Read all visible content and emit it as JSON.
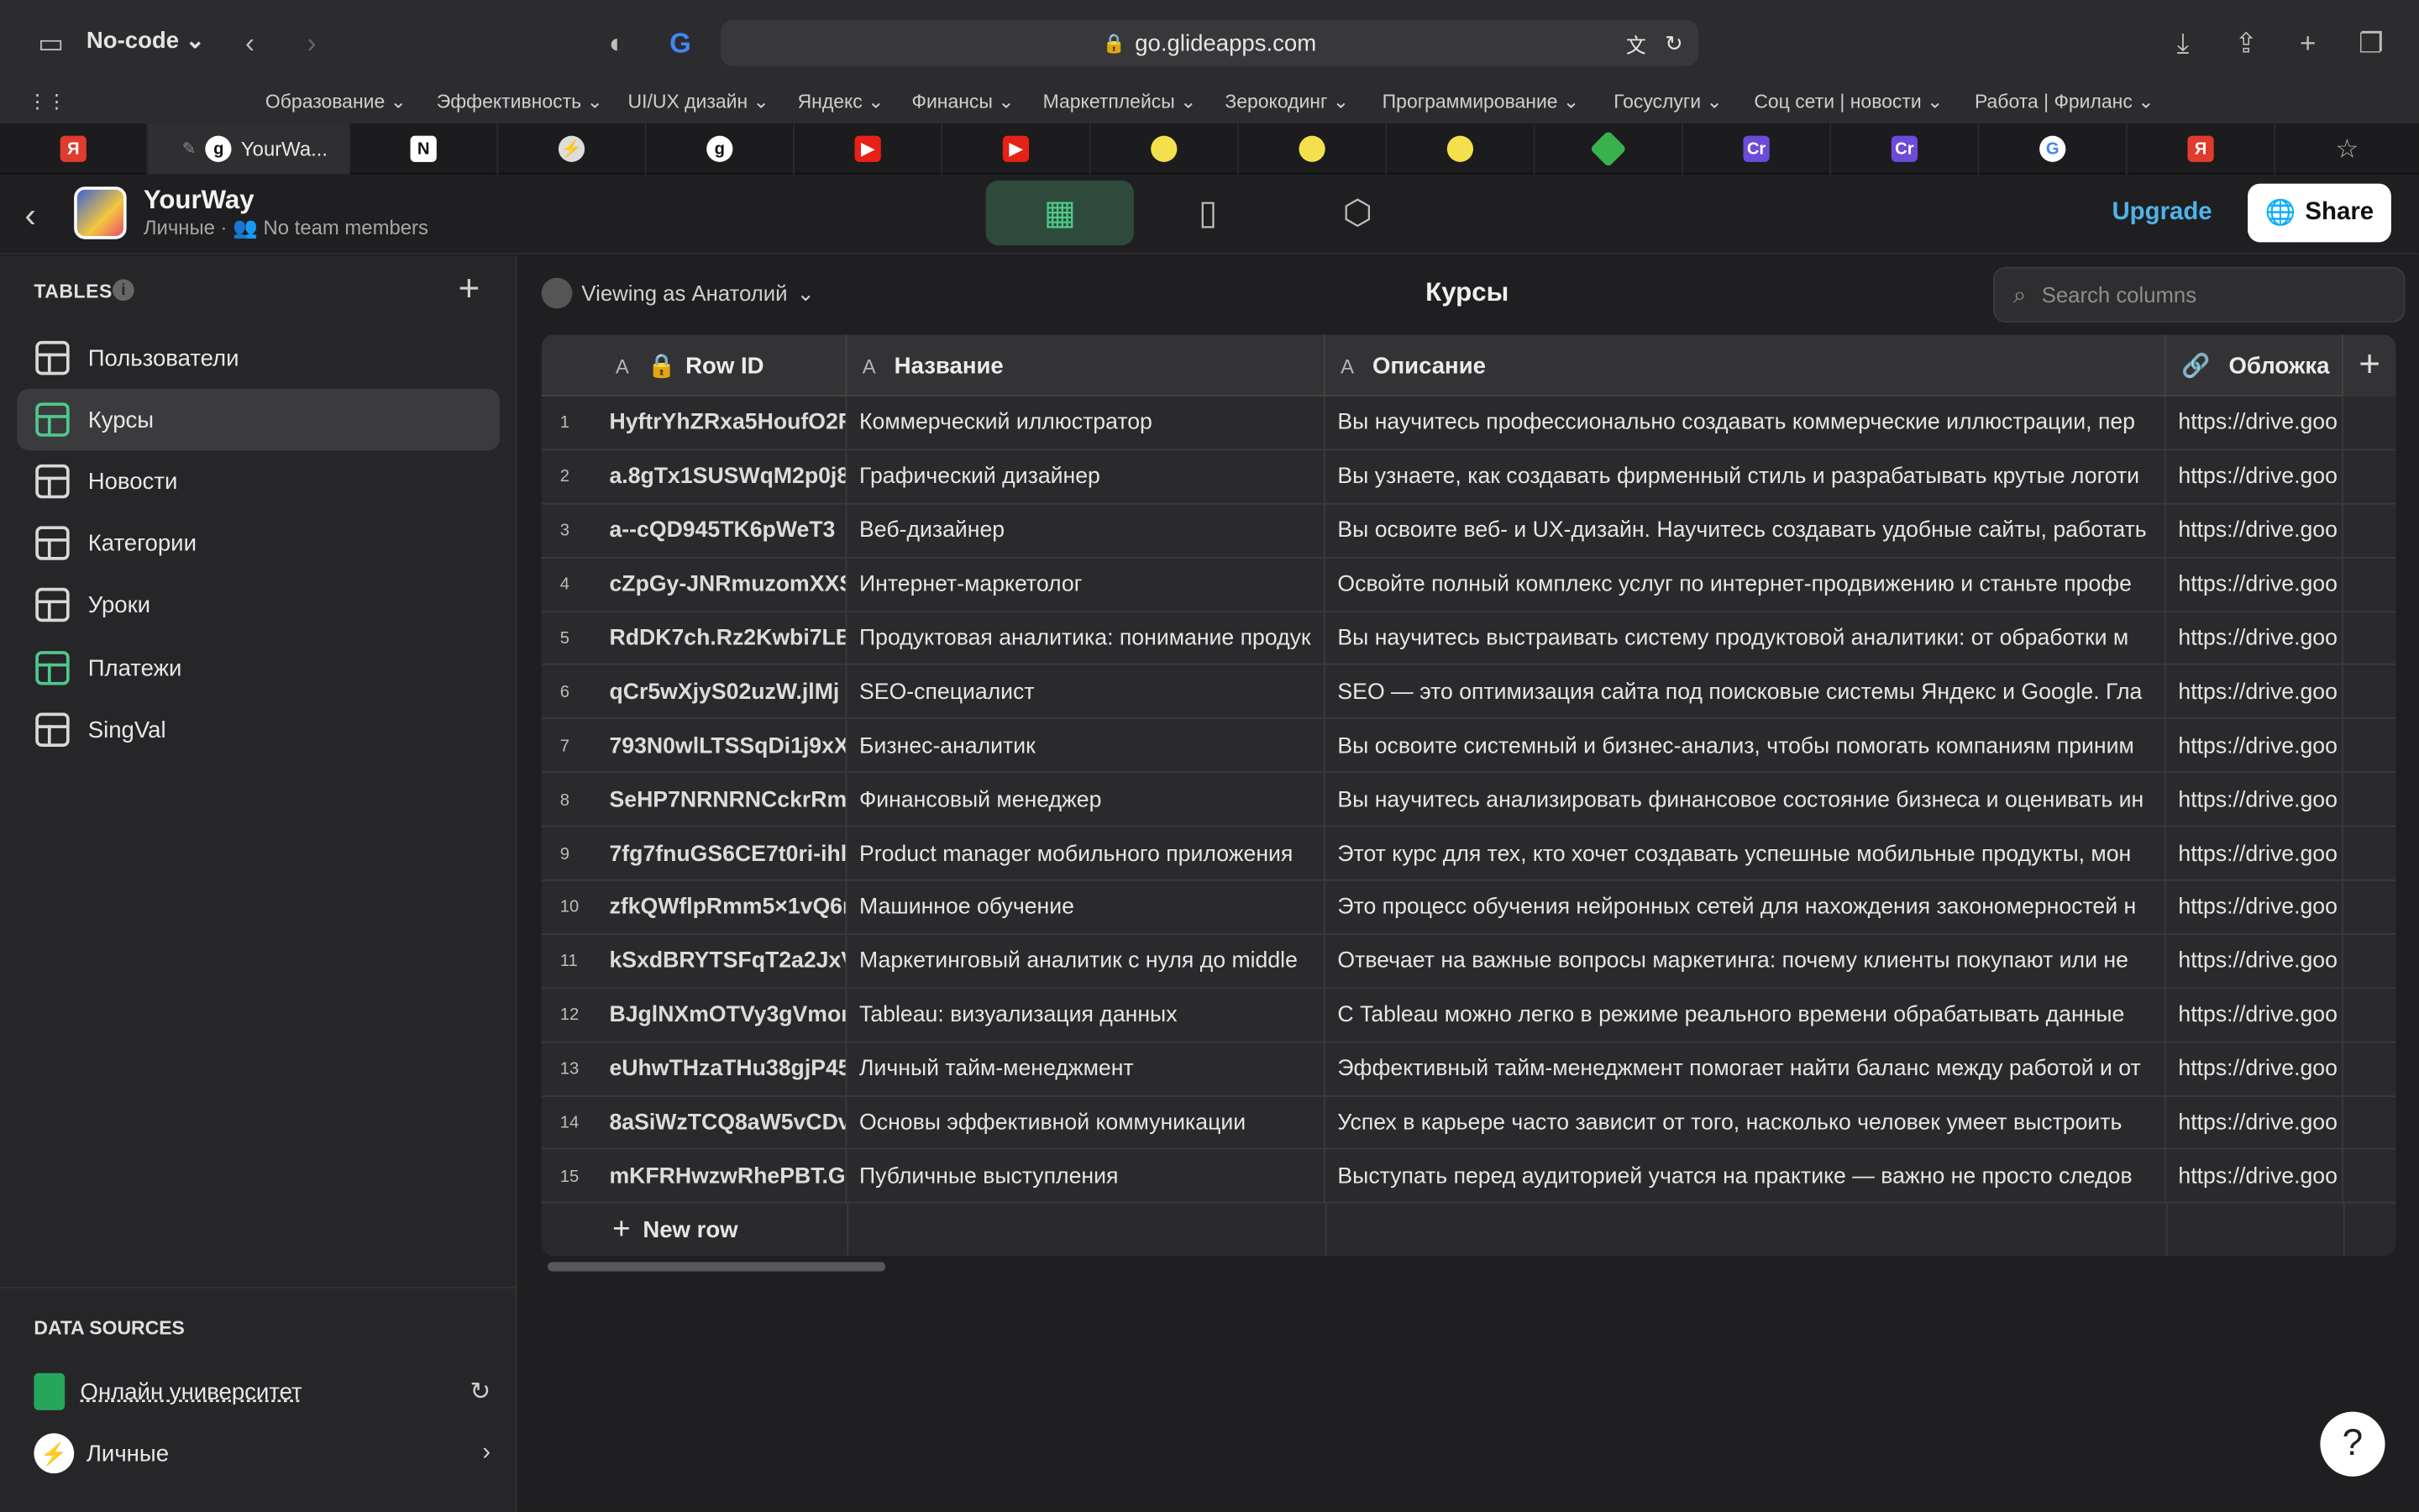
{
  "browser": {
    "profile": "No-code",
    "url": "go.glideapps.com",
    "bookmarks": [
      "Образование",
      "Эффективность",
      "UI/UX дизайн",
      "Яндекс",
      "Финансы",
      "Маркетплейсы",
      "Зерокодинг",
      "Программирование",
      "Госуслуги",
      "Соц сети | новости",
      "Работа | Фриланс"
    ],
    "active_tab_title": "YourWa..."
  },
  "app": {
    "name": "YourWay",
    "workspace": "Личные",
    "team": "No team members",
    "upgrade": "Upgrade",
    "share": "Share"
  },
  "sidebar": {
    "tables_title": "TABLES",
    "tables": [
      {
        "label": "Пользователи",
        "active": false
      },
      {
        "label": "Курсы",
        "active": true
      },
      {
        "label": "Новости",
        "active": false
      },
      {
        "label": "Категории",
        "active": false
      },
      {
        "label": "Уроки",
        "active": false
      },
      {
        "label": "Платежи",
        "active": false
      },
      {
        "label": "SingVal",
        "active": false
      }
    ],
    "data_sources_title": "DATA SOURCES",
    "data_sources": [
      {
        "label": "Онлайн университет"
      },
      {
        "label": "Личные"
      }
    ]
  },
  "main": {
    "viewing_as": "Viewing as Анатолий",
    "title": "Курсы",
    "search_placeholder": "Search columns",
    "columns": [
      {
        "label": "Row ID",
        "type": "A"
      },
      {
        "label": "Название",
        "type": "A"
      },
      {
        "label": "Описание",
        "type": "A"
      },
      {
        "label": "Обложка",
        "type": "link"
      }
    ],
    "rows": [
      {
        "n": "1",
        "id": "HyftrYhZRxa5HoufO2F",
        "name": "Коммерческий иллюстратор",
        "desc": "Вы научитесь профессионально создавать коммерческие иллюстрации, пер",
        "cover": "https://drive.goo"
      },
      {
        "n": "2",
        "id": "a.8gTx1SUSWqM2p0j8",
        "name": "Графический дизайнер",
        "desc": "Вы узнаете, как создавать фирменный стиль и разрабатывать крутые логоти",
        "cover": "https://drive.goo"
      },
      {
        "n": "3",
        "id": "a--cQD945TK6pWeT3",
        "name": "Веб-дизайнер",
        "desc": "Вы освоите веб- и UX-дизайн. Научитесь создавать удобные сайты, работать",
        "cover": "https://drive.goo"
      },
      {
        "n": "4",
        "id": "cZpGy-JNRmuzomXXS",
        "name": "Интернет-маркетолог",
        "desc": "Освойте полный комплекс услуг по интернет-продвижению и станьте профе",
        "cover": "https://drive.goo"
      },
      {
        "n": "5",
        "id": "RdDK7ch.Rz2Kwbi7LBI",
        "name": "Продуктовая аналитика: понимание продук",
        "desc": "Вы научитесь выстраивать систему продуктовой аналитики: от обработки м",
        "cover": "https://drive.goo"
      },
      {
        "n": "6",
        "id": "qCr5wXjyS02uzW.jlMj",
        "name": "SEO-специалист",
        "desc": "SEO — это оптимизация сайта под поисковые системы Яндекс и Google. Гла",
        "cover": "https://drive.goo"
      },
      {
        "n": "7",
        "id": "793N0wlLTSSqDi1j9xX",
        "name": "Бизнес-аналитик",
        "desc": "Вы освоите системный и бизнес-анализ, чтобы помогать компаниям приним",
        "cover": "https://drive.goo"
      },
      {
        "n": "8",
        "id": "SeHP7NRNRNCckrRmo",
        "name": "Финансовый менеджер",
        "desc": "Вы научитесь анализировать финансовое состояние бизнеса и оценивать ин",
        "cover": "https://drive.goo"
      },
      {
        "n": "9",
        "id": "7fg7fnuGS6CE7t0ri-ihl",
        "name": "Product manager мобильного приложения",
        "desc": "Этот курс для тех, кто хочет создавать успешные мобильные продукты, мон",
        "cover": "https://drive.goo"
      },
      {
        "n": "10",
        "id": "zfkQWflpRmm5×1vQ6n",
        "name": "Машинное обучение",
        "desc": "Это процесс обучения нейронных сетей для нахождения закономерностей н",
        "cover": "https://drive.goo"
      },
      {
        "n": "11",
        "id": "kSxdBRYTSFqT2a2JxV",
        "name": "Маркетинговый аналитик с нуля до middle",
        "desc": "Отвечает на важные вопросы маркетинга: почему клиенты покупают или не",
        "cover": "https://drive.goo"
      },
      {
        "n": "12",
        "id": "BJglNXmOTVy3gVmor",
        "name": "Tableau: визуализация данных",
        "desc": "С Tableau можно легко в режиме реального времени обрабатывать данные",
        "cover": "https://drive.goo"
      },
      {
        "n": "13",
        "id": "eUhwTHzaTHu38gjP45",
        "name": "Личный тайм-менеджмент",
        "desc": "Эффективный тайм-менеджмент помогает найти баланс между работой и от",
        "cover": "https://drive.goo"
      },
      {
        "n": "14",
        "id": "8aSiWzTCQ8aW5vCDv",
        "name": "Основы эффективной коммуникации",
        "desc": "Успех в карьере часто зависит от того, насколько человек умеет выстроить",
        "cover": "https://drive.goo"
      },
      {
        "n": "15",
        "id": "mKFRHwzwRhePBT.GN",
        "name": "Публичные выступления",
        "desc": "Выступать перед аудиторией учатся на практике — важно не просто следов",
        "cover": "https://drive.goo"
      }
    ],
    "new_row": "New row",
    "help": "?"
  },
  "colors": {
    "accent_green": "#4fc98a",
    "upgrade_blue": "#4fb3e8",
    "background": "#1f1f21"
  }
}
